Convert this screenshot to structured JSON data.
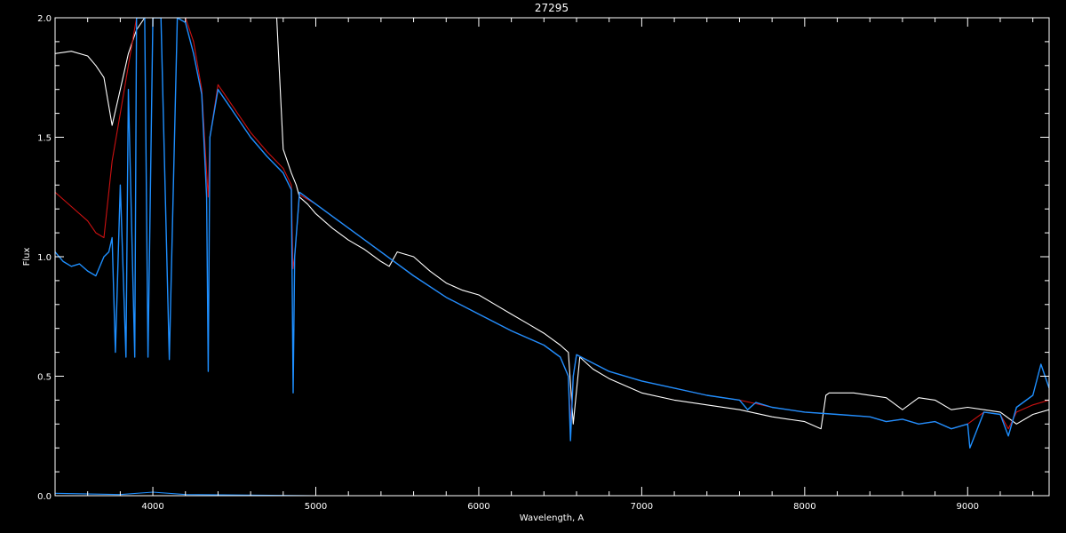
{
  "chart_data": {
    "type": "line",
    "title": "27295",
    "xlabel": "Wavelength, A",
    "ylabel": "Flux",
    "xlim": [
      3400,
      9500
    ],
    "ylim": [
      0.0,
      2.0
    ],
    "x_ticks": [
      4000,
      5000,
      6000,
      7000,
      8000,
      9000
    ],
    "x_tick_labels": [
      "4000",
      "5000",
      "6000",
      "7000",
      "8000",
      "9000"
    ],
    "y_ticks": [
      0.0,
      0.5,
      1.0,
      1.5,
      2.0
    ],
    "y_tick_labels": [
      "0.0",
      "0.5",
      "1.0",
      "1.5",
      "2.0"
    ],
    "grid": false,
    "background": "#000000",
    "axis_color": "#ffffff",
    "series": [
      {
        "color": "#ffffff",
        "x": [
          3400,
          3500,
          3600,
          3650,
          3700,
          3750,
          3800,
          3850,
          3900,
          3950,
          4000,
          4050,
          4100,
          4150,
          4200,
          4300,
          4400,
          4500,
          4600,
          4700,
          4750,
          4760,
          4800,
          4850,
          4880,
          4900,
          4950,
          5000,
          5100,
          5200,
          5300,
          5400,
          5450,
          5500,
          5600,
          5700,
          5800,
          5900,
          6000,
          6100,
          6200,
          6300,
          6400,
          6500,
          6550,
          6580,
          6620,
          6700,
          6800,
          6900,
          7000,
          7200,
          7400,
          7600,
          7800,
          8000,
          8100,
          8130,
          8150,
          8300,
          8500,
          8600,
          8700,
          8800,
          8900,
          9000,
          9100,
          9200,
          9300,
          9400,
          9500
        ],
        "y": [
          1.85,
          1.86,
          1.84,
          1.8,
          1.75,
          1.55,
          1.7,
          1.85,
          1.95,
          2.0,
          2.0,
          2.0,
          2.0,
          2.0,
          2.0,
          2.0,
          2.0,
          2.0,
          2.0,
          2.0,
          2.0,
          2.0,
          1.45,
          1.35,
          1.3,
          1.25,
          1.22,
          1.18,
          1.12,
          1.07,
          1.03,
          0.98,
          0.96,
          1.02,
          1.0,
          0.94,
          0.89,
          0.86,
          0.84,
          0.8,
          0.76,
          0.72,
          0.68,
          0.63,
          0.6,
          0.3,
          0.58,
          0.53,
          0.49,
          0.46,
          0.43,
          0.4,
          0.38,
          0.36,
          0.33,
          0.31,
          0.28,
          0.42,
          0.43,
          0.43,
          0.41,
          0.36,
          0.41,
          0.4,
          0.36,
          0.37,
          0.36,
          0.35,
          0.3,
          0.34,
          0.36
        ]
      },
      {
        "color": "#cc1111",
        "x": [
          3400,
          3500,
          3600,
          3650,
          3700,
          3750,
          3800,
          3850,
          3900,
          3950,
          4000,
          4050,
          4100,
          4150,
          4200,
          4250,
          4300,
          4330,
          4340,
          4350,
          4400,
          4500,
          4600,
          4700,
          4800,
          4850,
          4860,
          4870,
          4900,
          5000,
          5200,
          5400,
          5600,
          5800,
          6000,
          6200,
          6400,
          6500,
          6550,
          6563,
          6580,
          6600,
          6800,
          7000,
          7200,
          7400,
          7600,
          7800,
          8000,
          8200,
          8400,
          8500,
          8600,
          8700,
          8800,
          8900,
          9000,
          9100,
          9200,
          9250,
          9300,
          9400,
          9500
        ],
        "y": [
          1.27,
          1.21,
          1.15,
          1.1,
          1.08,
          1.4,
          1.6,
          1.8,
          2.0,
          2.0,
          2.0,
          2.0,
          2.0,
          2.0,
          2.0,
          1.9,
          1.7,
          1.35,
          1.25,
          1.5,
          1.72,
          1.62,
          1.52,
          1.44,
          1.37,
          1.3,
          0.95,
          1.0,
          1.26,
          1.22,
          1.12,
          1.02,
          0.92,
          0.83,
          0.76,
          0.69,
          0.63,
          0.58,
          0.5,
          0.3,
          0.5,
          0.59,
          0.52,
          0.48,
          0.45,
          0.42,
          0.4,
          0.37,
          0.35,
          0.34,
          0.33,
          0.31,
          0.32,
          0.3,
          0.31,
          0.28,
          0.3,
          0.35,
          0.34,
          0.28,
          0.35,
          0.38,
          0.4
        ]
      },
      {
        "color": "#1e8fff",
        "x": [
          3400,
          3450,
          3500,
          3550,
          3600,
          3650,
          3700,
          3730,
          3750,
          3770,
          3800,
          3835,
          3850,
          3889,
          3900,
          3950,
          3970,
          4000,
          4050,
          4101,
          4150,
          4200,
          4250,
          4300,
          4330,
          4340,
          4350,
          4400,
          4500,
          4600,
          4700,
          4800,
          4850,
          4861,
          4870,
          4900,
          5000,
          5200,
          5400,
          5600,
          5800,
          6000,
          6200,
          6400,
          6500,
          6550,
          6563,
          6580,
          6600,
          6800,
          7000,
          7200,
          7400,
          7600,
          7650,
          7700,
          7800,
          8000,
          8200,
          8400,
          8500,
          8600,
          8700,
          8800,
          8900,
          9000,
          9014,
          9100,
          9200,
          9250,
          9300,
          9400,
          9450,
          9500
        ],
        "y": [
          1.02,
          0.98,
          0.96,
          0.97,
          0.94,
          0.92,
          1.0,
          1.02,
          1.08,
          0.6,
          1.3,
          0.58,
          1.7,
          0.58,
          2.0,
          2.0,
          0.58,
          2.0,
          2.0,
          0.57,
          2.0,
          1.98,
          1.85,
          1.68,
          1.25,
          0.52,
          1.5,
          1.7,
          1.6,
          1.5,
          1.42,
          1.35,
          1.28,
          0.43,
          1.0,
          1.27,
          1.22,
          1.12,
          1.02,
          0.92,
          0.83,
          0.76,
          0.69,
          0.63,
          0.58,
          0.5,
          0.23,
          0.5,
          0.59,
          0.52,
          0.48,
          0.45,
          0.42,
          0.4,
          0.36,
          0.39,
          0.37,
          0.35,
          0.34,
          0.33,
          0.31,
          0.32,
          0.3,
          0.31,
          0.28,
          0.3,
          0.2,
          0.35,
          0.34,
          0.25,
          0.37,
          0.42,
          0.55,
          0.45
        ]
      },
      {
        "color": "#1e8fff",
        "x": [
          3400,
          3800,
          4000,
          4200,
          5000,
          6000,
          7000,
          8000,
          9000,
          9400,
          9500
        ],
        "y": [
          0.01,
          0.005,
          0.015,
          0.005,
          0.0,
          0.0,
          0.0,
          0.0,
          0.0,
          0.0,
          0.0
        ]
      }
    ]
  }
}
